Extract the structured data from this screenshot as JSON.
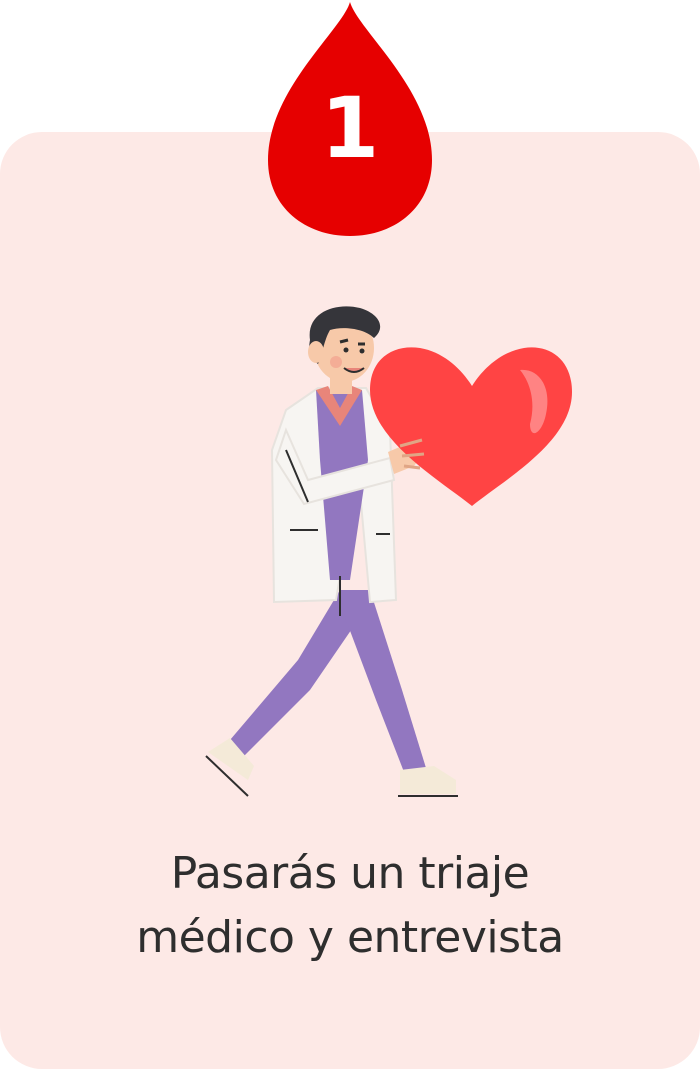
{
  "step": {
    "number": "1",
    "title_line1": "Pasarás un triaje",
    "title_line2": "médico y entrevista"
  },
  "illustration": {
    "icon": "doctor-holding-heart-icon"
  },
  "colors": {
    "card_background": "#fde9e6",
    "drop": "#e60000",
    "heart": "#ff4444",
    "scrubs": "#9277c0",
    "text": "#2e2e2e"
  }
}
